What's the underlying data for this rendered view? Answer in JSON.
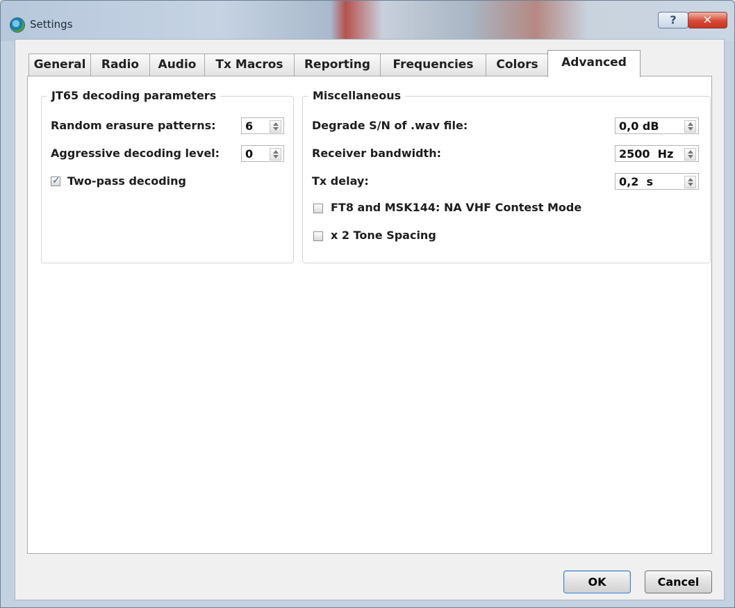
{
  "window": {
    "title": "Settings",
    "help_label": "?",
    "close_label": "✕"
  },
  "tabs": [
    {
      "label": "General",
      "active": false
    },
    {
      "label": "Radio",
      "active": false
    },
    {
      "label": "Audio",
      "active": false
    },
    {
      "label": "Tx Macros",
      "active": false
    },
    {
      "label": "Reporting",
      "active": false
    },
    {
      "label": "Frequencies",
      "active": false
    },
    {
      "label": "Colors",
      "active": false
    },
    {
      "label": "Advanced",
      "active": true
    }
  ],
  "jt65_group": {
    "title": "JT65 decoding parameters",
    "random_erasure_label": "Random erasure patterns:",
    "random_erasure_value": "6",
    "aggressive_label": "Aggressive decoding level:",
    "aggressive_value": "0",
    "two_pass_label": "Two-pass decoding",
    "two_pass_checked": true
  },
  "misc_group": {
    "title": "Miscellaneous",
    "degrade_label": "Degrade S/N of .wav file:",
    "degrade_value": "0,0 dB",
    "bandwidth_label": "Receiver bandwidth:",
    "bandwidth_value": "2500  Hz",
    "tx_delay_label": "Tx delay:",
    "tx_delay_value": "0,2  s",
    "ft8_contest_label": "FT8 and MSK144:  NA VHF Contest Mode",
    "ft8_contest_checked": false,
    "tone_spacing_label": "x 2 Tone Spacing",
    "tone_spacing_checked": false
  },
  "buttons": {
    "ok": "OK",
    "cancel": "Cancel"
  },
  "colors": {
    "active_tab": "#ffffff",
    "close_button": "#d64a36",
    "checkbox_mark": "#3e6795"
  },
  "icons": {
    "app": "settings-app-icon",
    "check": "checkbox-checkmark-icon",
    "spin_up": "spin-up-icon",
    "spin_down": "spin-down-icon"
  }
}
